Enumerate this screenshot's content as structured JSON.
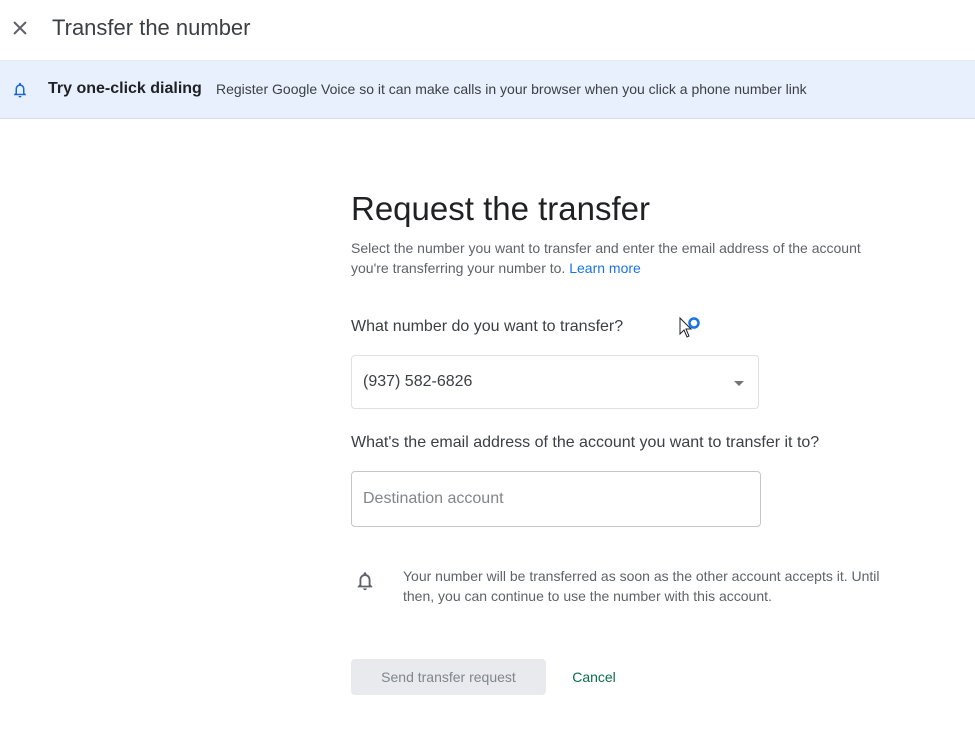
{
  "header": {
    "title": "Transfer the number",
    "close_icon": "close-icon"
  },
  "banner": {
    "icon": "bell-icon",
    "title": "Try one-click dialing",
    "text": "Register Google Voice so it can make calls in your browser when you click a phone number link",
    "background": "#e8f0fe"
  },
  "main": {
    "heading": "Request the transfer",
    "description": "Select the number you want to transfer and enter the email address of the account you're transferring your number to.",
    "learn_more": "Learn more",
    "number_question": "What number do you want to transfer?",
    "selected_number": "(937) 582-6826",
    "email_question": "What's the email address of the account you want to transfer it to?",
    "destination_placeholder": "Destination account",
    "destination_value": "",
    "note_icon": "bell-icon",
    "note": "Your number will be transferred as soon as the other account accepts it. Until then, you can continue to use the number with this account."
  },
  "actions": {
    "send_label": "Send transfer request",
    "cancel_label": "Cancel"
  },
  "colors": {
    "link": "#1a73e8",
    "cancel": "#0b6e4f",
    "disabled_button_bg": "#e8eaed"
  }
}
